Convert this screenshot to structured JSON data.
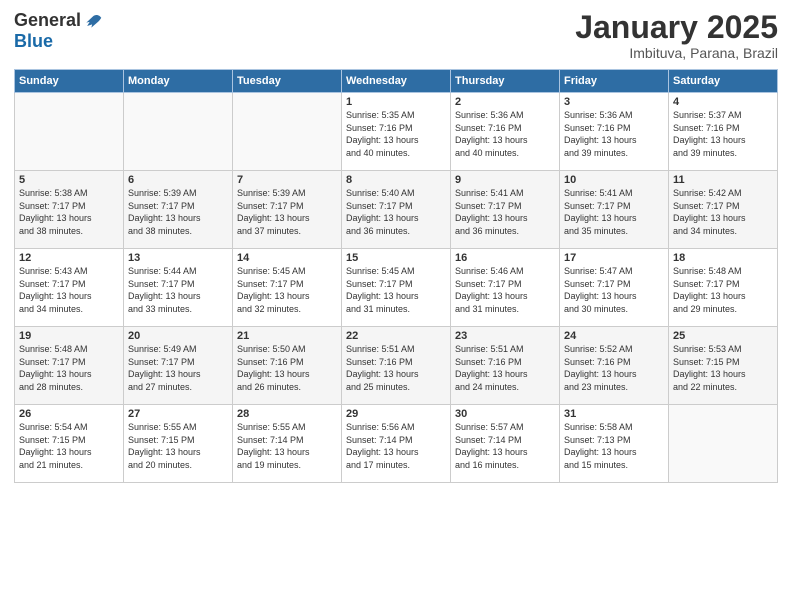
{
  "header": {
    "logo_general": "General",
    "logo_blue": "Blue",
    "month": "January 2025",
    "location": "Imbituva, Parana, Brazil"
  },
  "days_of_week": [
    "Sunday",
    "Monday",
    "Tuesday",
    "Wednesday",
    "Thursday",
    "Friday",
    "Saturday"
  ],
  "weeks": [
    [
      {
        "day": "",
        "info": ""
      },
      {
        "day": "",
        "info": ""
      },
      {
        "day": "",
        "info": ""
      },
      {
        "day": "1",
        "info": "Sunrise: 5:35 AM\nSunset: 7:16 PM\nDaylight: 13 hours\nand 40 minutes."
      },
      {
        "day": "2",
        "info": "Sunrise: 5:36 AM\nSunset: 7:16 PM\nDaylight: 13 hours\nand 40 minutes."
      },
      {
        "day": "3",
        "info": "Sunrise: 5:36 AM\nSunset: 7:16 PM\nDaylight: 13 hours\nand 39 minutes."
      },
      {
        "day": "4",
        "info": "Sunrise: 5:37 AM\nSunset: 7:16 PM\nDaylight: 13 hours\nand 39 minutes."
      }
    ],
    [
      {
        "day": "5",
        "info": "Sunrise: 5:38 AM\nSunset: 7:17 PM\nDaylight: 13 hours\nand 38 minutes."
      },
      {
        "day": "6",
        "info": "Sunrise: 5:39 AM\nSunset: 7:17 PM\nDaylight: 13 hours\nand 38 minutes."
      },
      {
        "day": "7",
        "info": "Sunrise: 5:39 AM\nSunset: 7:17 PM\nDaylight: 13 hours\nand 37 minutes."
      },
      {
        "day": "8",
        "info": "Sunrise: 5:40 AM\nSunset: 7:17 PM\nDaylight: 13 hours\nand 36 minutes."
      },
      {
        "day": "9",
        "info": "Sunrise: 5:41 AM\nSunset: 7:17 PM\nDaylight: 13 hours\nand 36 minutes."
      },
      {
        "day": "10",
        "info": "Sunrise: 5:41 AM\nSunset: 7:17 PM\nDaylight: 13 hours\nand 35 minutes."
      },
      {
        "day": "11",
        "info": "Sunrise: 5:42 AM\nSunset: 7:17 PM\nDaylight: 13 hours\nand 34 minutes."
      }
    ],
    [
      {
        "day": "12",
        "info": "Sunrise: 5:43 AM\nSunset: 7:17 PM\nDaylight: 13 hours\nand 34 minutes."
      },
      {
        "day": "13",
        "info": "Sunrise: 5:44 AM\nSunset: 7:17 PM\nDaylight: 13 hours\nand 33 minutes."
      },
      {
        "day": "14",
        "info": "Sunrise: 5:45 AM\nSunset: 7:17 PM\nDaylight: 13 hours\nand 32 minutes."
      },
      {
        "day": "15",
        "info": "Sunrise: 5:45 AM\nSunset: 7:17 PM\nDaylight: 13 hours\nand 31 minutes."
      },
      {
        "day": "16",
        "info": "Sunrise: 5:46 AM\nSunset: 7:17 PM\nDaylight: 13 hours\nand 31 minutes."
      },
      {
        "day": "17",
        "info": "Sunrise: 5:47 AM\nSunset: 7:17 PM\nDaylight: 13 hours\nand 30 minutes."
      },
      {
        "day": "18",
        "info": "Sunrise: 5:48 AM\nSunset: 7:17 PM\nDaylight: 13 hours\nand 29 minutes."
      }
    ],
    [
      {
        "day": "19",
        "info": "Sunrise: 5:48 AM\nSunset: 7:17 PM\nDaylight: 13 hours\nand 28 minutes."
      },
      {
        "day": "20",
        "info": "Sunrise: 5:49 AM\nSunset: 7:17 PM\nDaylight: 13 hours\nand 27 minutes."
      },
      {
        "day": "21",
        "info": "Sunrise: 5:50 AM\nSunset: 7:16 PM\nDaylight: 13 hours\nand 26 minutes."
      },
      {
        "day": "22",
        "info": "Sunrise: 5:51 AM\nSunset: 7:16 PM\nDaylight: 13 hours\nand 25 minutes."
      },
      {
        "day": "23",
        "info": "Sunrise: 5:51 AM\nSunset: 7:16 PM\nDaylight: 13 hours\nand 24 minutes."
      },
      {
        "day": "24",
        "info": "Sunrise: 5:52 AM\nSunset: 7:16 PM\nDaylight: 13 hours\nand 23 minutes."
      },
      {
        "day": "25",
        "info": "Sunrise: 5:53 AM\nSunset: 7:15 PM\nDaylight: 13 hours\nand 22 minutes."
      }
    ],
    [
      {
        "day": "26",
        "info": "Sunrise: 5:54 AM\nSunset: 7:15 PM\nDaylight: 13 hours\nand 21 minutes."
      },
      {
        "day": "27",
        "info": "Sunrise: 5:55 AM\nSunset: 7:15 PM\nDaylight: 13 hours\nand 20 minutes."
      },
      {
        "day": "28",
        "info": "Sunrise: 5:55 AM\nSunset: 7:14 PM\nDaylight: 13 hours\nand 19 minutes."
      },
      {
        "day": "29",
        "info": "Sunrise: 5:56 AM\nSunset: 7:14 PM\nDaylight: 13 hours\nand 17 minutes."
      },
      {
        "day": "30",
        "info": "Sunrise: 5:57 AM\nSunset: 7:14 PM\nDaylight: 13 hours\nand 16 minutes."
      },
      {
        "day": "31",
        "info": "Sunrise: 5:58 AM\nSunset: 7:13 PM\nDaylight: 13 hours\nand 15 minutes."
      },
      {
        "day": "",
        "info": ""
      }
    ]
  ]
}
